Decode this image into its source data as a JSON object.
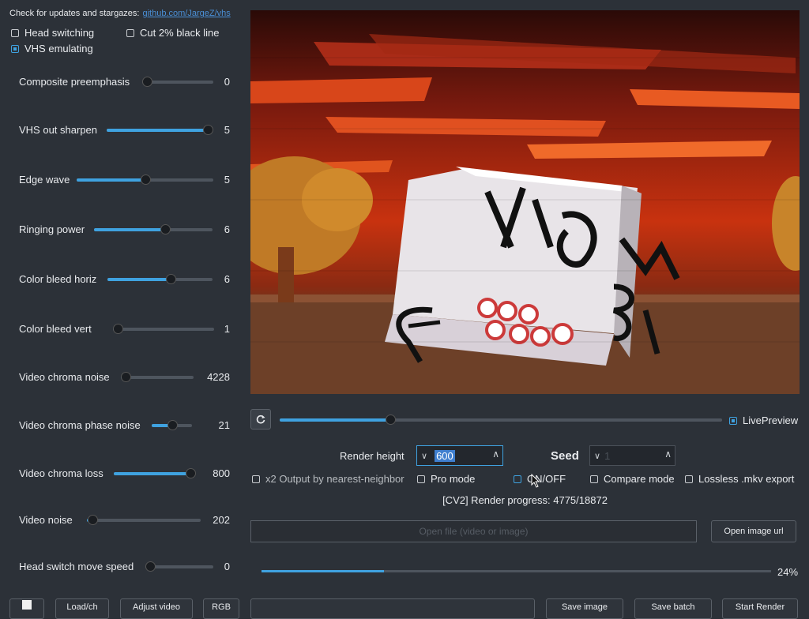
{
  "header": {
    "text": "Check for updates and stargazes:",
    "link": "github.com/JargeZ/vhs"
  },
  "options_top": {
    "head_switching": "Head switching",
    "cut_black_line": "Cut 2% black line",
    "vhs_emulating": "VHS emulating"
  },
  "sliders": [
    {
      "label": "Composite preemphasis",
      "value": "0",
      "fraction": 0.0
    },
    {
      "label": "VHS out sharpen",
      "value": "5",
      "fraction": 1.0
    },
    {
      "label": "Edge wave",
      "value": "5",
      "fraction": 0.5
    },
    {
      "label": "Ringing power",
      "value": "6",
      "fraction": 0.6
    },
    {
      "label": "Color bleed horiz",
      "value": "6",
      "fraction": 0.6
    },
    {
      "label": "Color bleed vert",
      "value": "1",
      "fraction": 0.05
    },
    {
      "label": "Video chroma noise",
      "value": "4228",
      "fraction": 0.05
    },
    {
      "label": "Video chroma phase noise",
      "value": "21",
      "fraction": 0.5
    },
    {
      "label": "Video chroma loss",
      "value": "800",
      "fraction": 1.0
    },
    {
      "label": "Video noise",
      "value": "202",
      "fraction": 0.05
    },
    {
      "label": "Head switch move speed",
      "value": "0",
      "fraction": 0.0
    }
  ],
  "preview": {
    "timeline_fraction": 0.25,
    "live_preview": "LivePreview"
  },
  "render": {
    "height_label": "Render height",
    "height_value": "600",
    "seed_label": "Seed",
    "seed_value": "1"
  },
  "options": {
    "x2_output": "x2 Output by nearest-neighbor",
    "pro_mode": "Pro mode",
    "on_off": "ON/OFF",
    "compare_mode": "Compare mode",
    "lossless": "Lossless .mkv export"
  },
  "status": "[CV2] Render progress: 4775/18872",
  "file": {
    "placeholder": "Open file (video or image)",
    "open_url": "Open image url"
  },
  "progress": {
    "fraction": 0.24,
    "percent": "24%"
  },
  "bottom_buttons": {
    "btn2": "Load/ch",
    "btn3": "Adjust video",
    "btn4": "RGB",
    "btn5": "Save image",
    "btn6": "Save batch",
    "btn7": "Start Render"
  },
  "colors": {
    "accent": "#3fa2e0",
    "background": "#2c3138"
  }
}
